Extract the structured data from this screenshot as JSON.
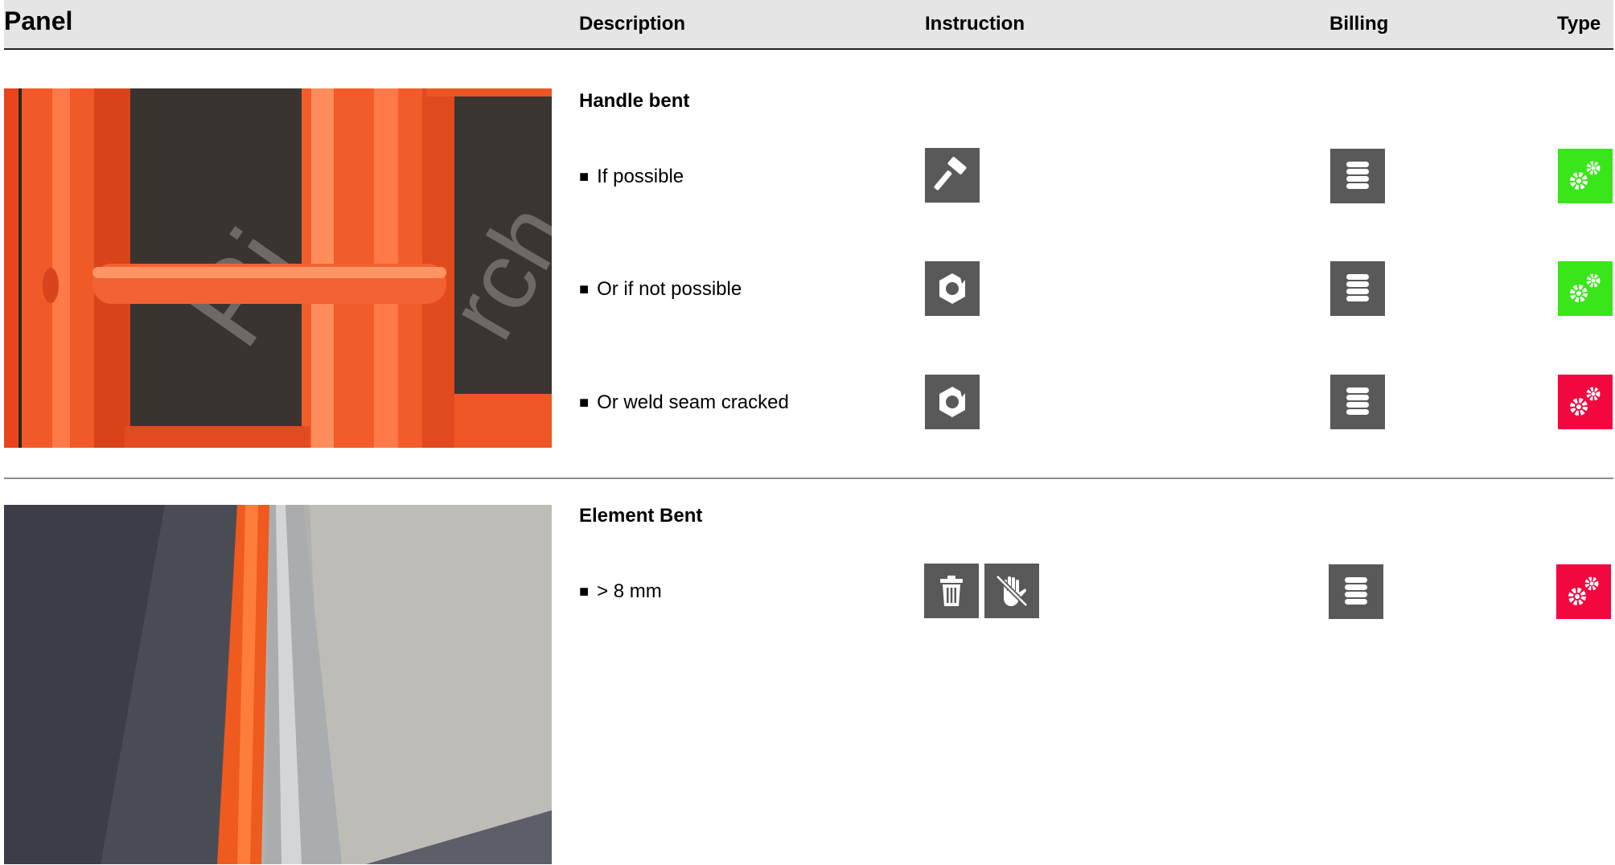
{
  "header": {
    "panel": "Panel",
    "description": "Description",
    "instruction": "Instruction",
    "billing": "Billing",
    "type": "Type"
  },
  "colors": {
    "header_bg": "#e5e5e5",
    "icon_bg": "#595959",
    "type_green": "#39e619",
    "type_red": "#f2073f"
  },
  "sections": [
    {
      "title": "Handle bent",
      "rows": [
        {
          "bullet": "■",
          "label": "If possible",
          "instruction_icons": [
            "hammer-icon"
          ],
          "billing_icon": "coin-stack-icon",
          "type": "green"
        },
        {
          "bullet": "■",
          "label": "Or if not possible",
          "instruction_icons": [
            "broken-nut-icon"
          ],
          "billing_icon": "coin-stack-icon",
          "type": "green"
        },
        {
          "bullet": "■",
          "label": "Or weld seam cracked",
          "instruction_icons": [
            "broken-nut-icon"
          ],
          "billing_icon": "coin-stack-icon",
          "type": "red"
        }
      ]
    },
    {
      "title": "Element Bent",
      "rows": [
        {
          "bullet": "■",
          "label": "> 8 mm",
          "instruction_icons": [
            "trash-icon",
            "no-touch-icon"
          ],
          "billing_icon": "coin-stack-icon",
          "type": "red"
        }
      ]
    }
  ]
}
